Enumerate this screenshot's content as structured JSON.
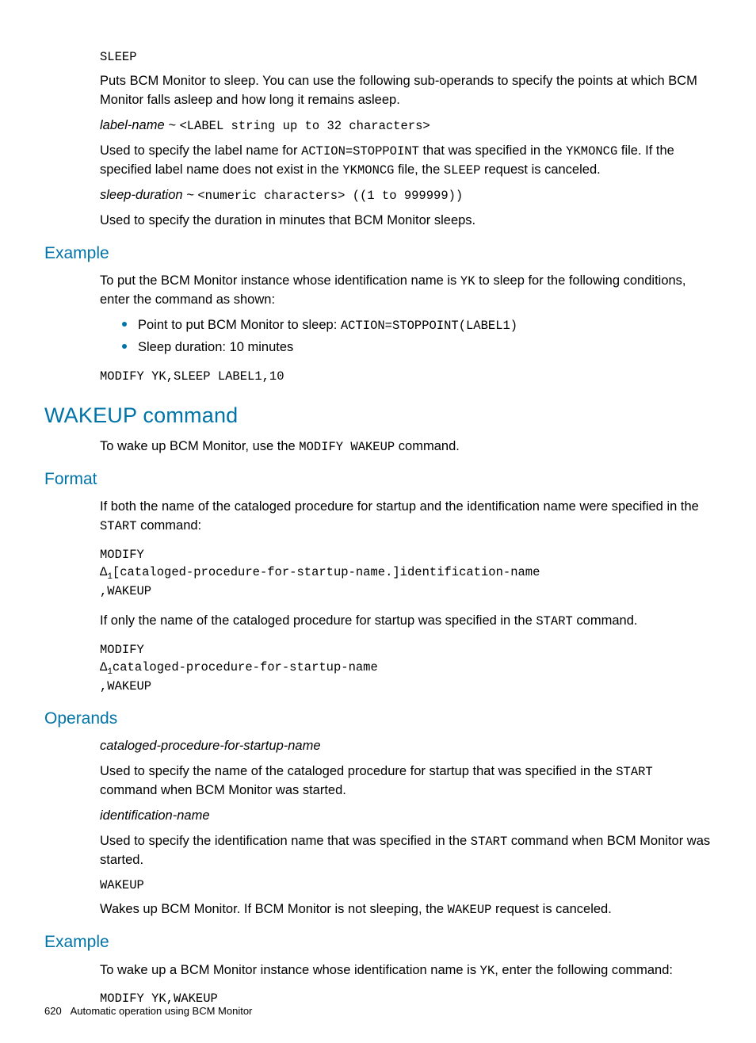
{
  "section_sleep": {
    "sleep_label": "SLEEP",
    "sleep_desc": "Puts BCM Monitor to sleep. You can use the following sub-operands to specify the points at which BCM Monitor falls asleep and how long it remains asleep.",
    "labelname_prefix": "label-name ~ ",
    "labelname_code": "<LABEL string up to 32 characters>",
    "labelname_desc_part1": "Used to specify the label name for ",
    "labelname_desc_code1": "ACTION=STOPPOINT",
    "labelname_desc_part2": " that was specified in the ",
    "labelname_desc_code2": "YKMONCG",
    "labelname_desc_part3": " file. If the specified label name does not exist in the ",
    "labelname_desc_code3": "YKMONCG",
    "labelname_desc_part4": " file, the ",
    "labelname_desc_code4": "SLEEP",
    "labelname_desc_part5": " request is canceled.",
    "sleepdur_prefix": "sleep-duration ~ ",
    "sleepdur_code": "<numeric characters> ((1 to 999999))",
    "sleepdur_desc": "Used to specify the duration in minutes that BCM Monitor sleeps."
  },
  "section_example1": {
    "heading": "Example",
    "intro_part1": "To put the BCM Monitor instance whose identification name is ",
    "intro_code": "YK",
    "intro_part2": " to sleep for the following conditions, enter the command as shown:",
    "bullet1_part1": "Point to put BCM Monitor to sleep: ",
    "bullet1_code": "ACTION=STOPPOINT(LABEL1)",
    "bullet2": "Sleep duration: 10 minutes",
    "codeblock": "MODIFY YK,SLEEP LABEL1,10"
  },
  "section_wakeup": {
    "heading": "WAKEUP command",
    "intro_part1": "To wake up BCM Monitor, use the ",
    "intro_code": "MODIFY WAKEUP",
    "intro_part2": " command."
  },
  "section_format": {
    "heading": "Format",
    "intro_part1": "If both the name of the cataloged procedure for startup and the identification name were specified in the ",
    "intro_code": "START",
    "intro_part2": " command:",
    "codeblock1_l1": "MODIFY",
    "codeblock1_l2a": "Δ",
    "codeblock1_l2sub": "1",
    "codeblock1_l2b": "[cataloged-procedure-for-startup-name.]identification-name",
    "codeblock1_l3": ",WAKEUP",
    "mid_part1": "If only the name of the cataloged procedure for startup was specified in the ",
    "mid_code": "START",
    "mid_part2": " command.",
    "codeblock2_l1": "MODIFY",
    "codeblock2_l2a": "Δ",
    "codeblock2_l2sub": "1",
    "codeblock2_l2b": "cataloged-procedure-for-startup-name",
    "codeblock2_l3": ",WAKEUP"
  },
  "section_operands": {
    "heading": "Operands",
    "op1_name": "cataloged-procedure-for-startup-name",
    "op1_desc_part1": "Used to specify the name of the cataloged procedure for startup that was specified in the ",
    "op1_desc_code": "START",
    "op1_desc_part2": " command when BCM Monitor was started.",
    "op2_name": "identification-name",
    "op2_desc_part1": "Used to specify the identification name that was specified in the ",
    "op2_desc_code": "START",
    "op2_desc_part2": " command when BCM Monitor was started.",
    "op3_name": "WAKEUP",
    "op3_desc_part1": "Wakes up BCM Monitor. If BCM Monitor is not sleeping, the ",
    "op3_desc_code": "WAKEUP",
    "op3_desc_part2": " request is canceled."
  },
  "section_example2": {
    "heading": "Example",
    "intro_part1": "To wake up a BCM Monitor instance whose identification name is ",
    "intro_code": "YK",
    "intro_part2": ", enter the following command:",
    "codeblock": "MODIFY YK,WAKEUP"
  },
  "footer": {
    "page_number": "620",
    "chapter": "Automatic operation using BCM Monitor"
  }
}
